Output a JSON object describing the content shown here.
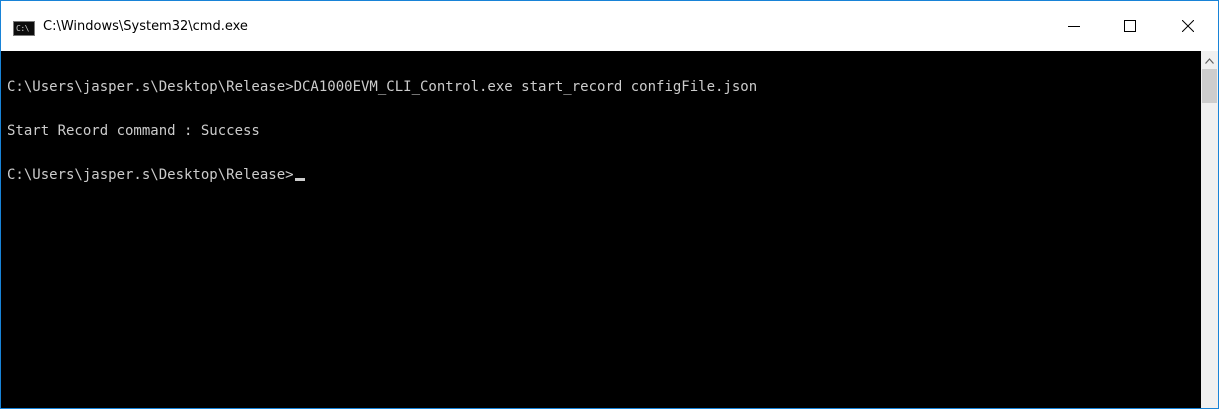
{
  "window": {
    "title": "C:\\Windows\\System32\\cmd.exe",
    "icon": "cmd-icon",
    "icon_label": "C:\\",
    "controls": [
      "minimize-icon",
      "maximize-icon",
      "close-icon"
    ]
  },
  "console": {
    "lines": [
      "C:\\Users\\jasper.s\\Desktop\\Release>DCA1000EVM_CLI_Control.exe start_record configFile.json",
      "Start Record command : Success",
      "C:\\Users\\jasper.s\\Desktop\\Release>"
    ]
  },
  "colors": {
    "console_bg": "#000000",
    "console_text": "#cccccc",
    "titlebar_bg": "#ffffff",
    "border": "#1883d7"
  }
}
